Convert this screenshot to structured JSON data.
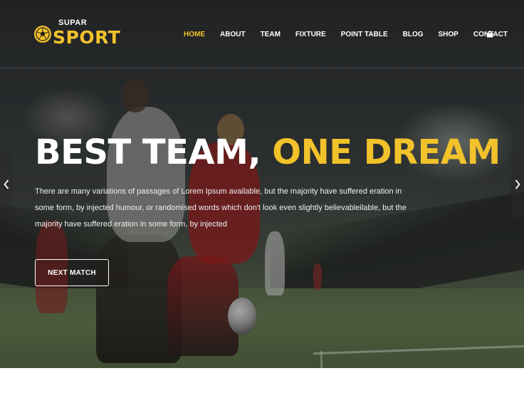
{
  "logo": {
    "top_text": "SUPAR",
    "main_text": "SPORT",
    "icon": "soccer-ball-icon"
  },
  "nav": {
    "items": [
      {
        "label": "HOME",
        "active": true
      },
      {
        "label": "ABOUT",
        "active": false
      },
      {
        "label": "TEAM",
        "active": false
      },
      {
        "label": "FIXTURE",
        "active": false
      },
      {
        "label": "POINT TABLE",
        "active": false
      },
      {
        "label": "BLOG",
        "active": false
      },
      {
        "label": "SHOP",
        "active": false
      },
      {
        "label": "CONTACT",
        "active": false
      }
    ],
    "cart_icon": "cart-icon"
  },
  "hero": {
    "headline_white": "BEST TEAM,",
    "headline_yellow": "ONE DREAM",
    "description": "There are many variations of passages of Lorem Ipsum available, but the majority have suffered eration in some form, by injected humour, or randomised words which don't look even slightly believableilable, but the majority have suffered eration in some form, by injected",
    "cta_label": "NEXT MATCH",
    "prev_icon": "chevron-left-icon",
    "next_icon": "chevron-right-icon"
  },
  "colors": {
    "accent": "#f2c22b",
    "text": "#ffffff"
  }
}
